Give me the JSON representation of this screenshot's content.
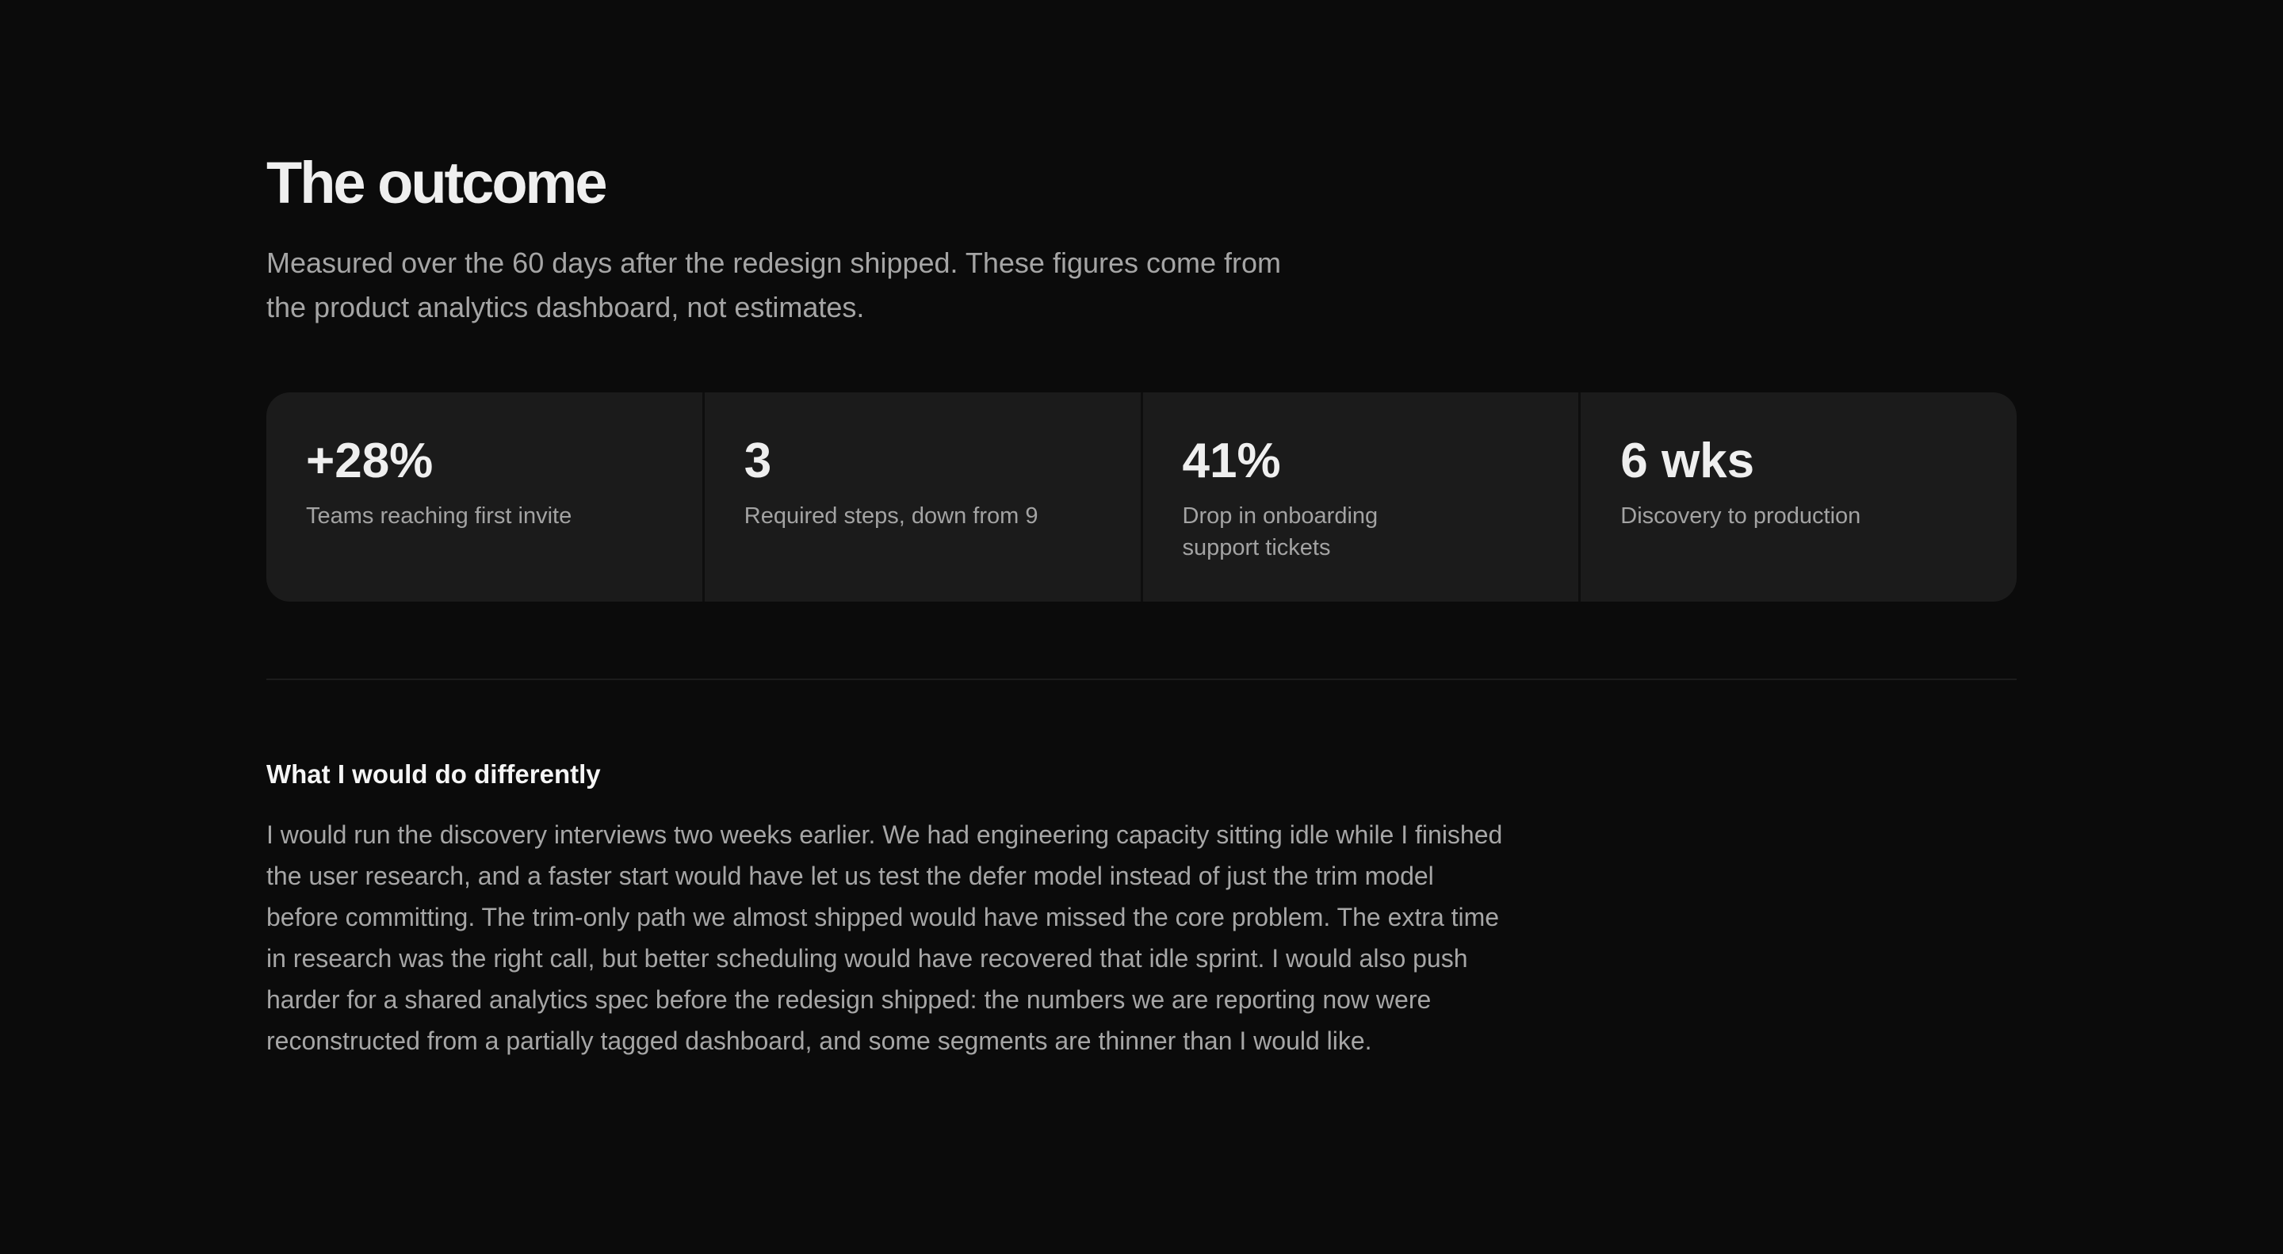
{
  "outcome": {
    "title": "The outcome",
    "lede": "Measured over the 60 days after the redesign shipped. These figures come from the product analytics dashboard, not estimates."
  },
  "stats": [
    {
      "value": "+28%",
      "label": "Teams reaching first invite"
    },
    {
      "value": "3",
      "label": "Required steps, down from 9"
    },
    {
      "value": "41%",
      "label": "Drop in onboarding support tickets"
    },
    {
      "value": "6 wks",
      "label": "Discovery to production"
    }
  ],
  "reflection": {
    "heading": "What I would do differently",
    "body": "I would run the discovery interviews two weeks earlier. We had engineering capacity sitting idle while I finished the user research, and a faster start would have let us test the defer model instead of just the trim model before committing. The trim-only path we almost shipped would have missed the core problem. The extra time in research was the right call, but better scheduling would have recovered that idle sprint. I would also push harder for a shared analytics spec before the redesign shipped: the numbers we are reporting now were reconstructed from a partially tagged dashboard, and some segments are thinner than I would like."
  },
  "colors": {
    "background": "#0b0b0b",
    "card": "#1b1b1b",
    "heading": "#efefef",
    "muted_text": "#a5a5a5"
  }
}
